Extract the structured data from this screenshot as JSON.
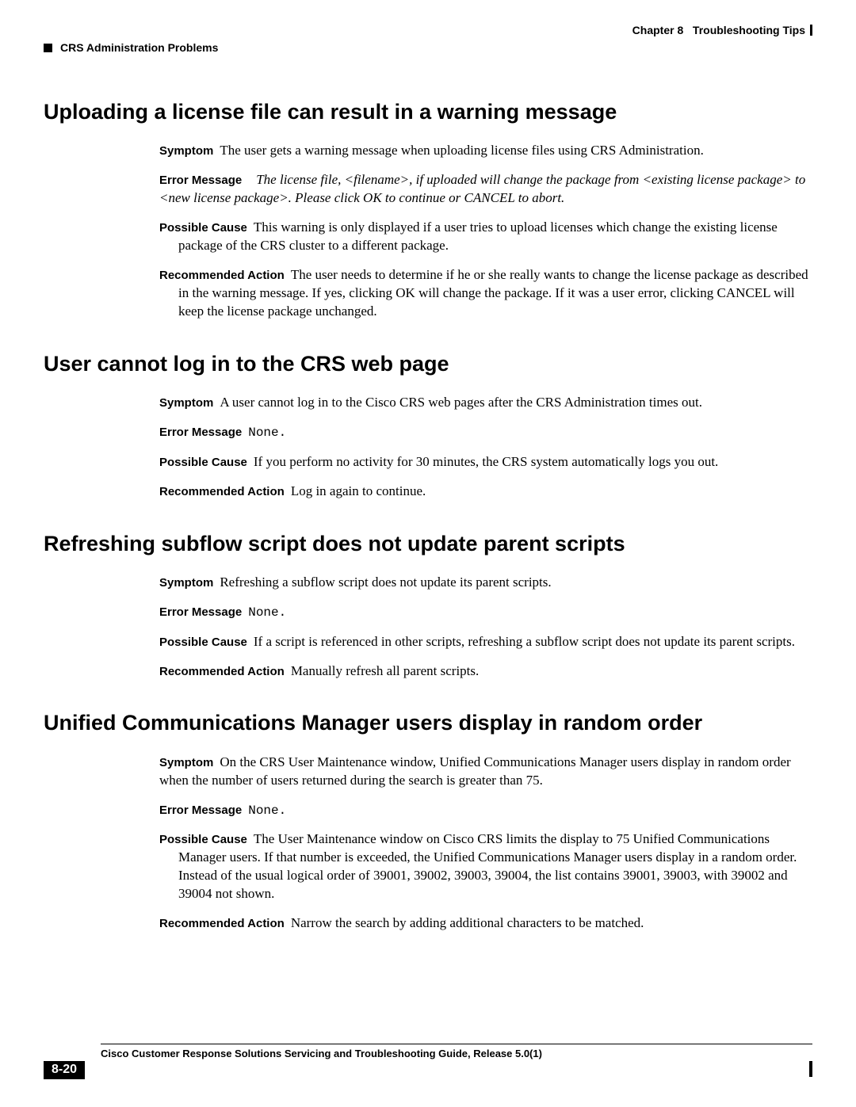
{
  "header": {
    "chapter_label": "Chapter 8",
    "chapter_title": "Troubleshooting Tips",
    "section_title": "CRS Administration Problems"
  },
  "labels": {
    "symptom": "Symptom",
    "error_message": "Error Message",
    "possible_cause": "Possible Cause",
    "recommended_action": "Recommended Action",
    "none": "None."
  },
  "sections": [
    {
      "heading": "Uploading a license file can result in a warning message",
      "symptom": "The user gets a warning message when uploading license files using CRS Administration.",
      "error_msg": "The license file, <filename>, if uploaded will change the package from <existing license package> to <new license package>. Please click OK to continue or CANCEL to abort.",
      "error_is_none": false,
      "cause": "This warning is only displayed if a user tries to upload licenses which change the existing license package of the CRS cluster to a different package.",
      "action": "The user needs to determine if he or she really wants to change the license package as described in the warning message. If yes, clicking OK will change the package. If it was a user error, clicking CANCEL will keep the license package unchanged."
    },
    {
      "heading": "User cannot log in to the CRS web page",
      "symptom": "A user cannot log in to the Cisco CRS web pages after the CRS Administration times out.",
      "error_msg": "",
      "error_is_none": true,
      "cause": "If you perform no activity for 30 minutes, the CRS system automatically logs you out.",
      "action": "Log in again to continue."
    },
    {
      "heading": "Refreshing subflow script does not update parent scripts",
      "symptom": "Refreshing a subflow script does not update its parent scripts.",
      "error_msg": "",
      "error_is_none": true,
      "cause": "If a script is referenced in other scripts, refreshing a subflow script does not update its parent scripts.",
      "action": "Manually refresh all parent scripts."
    },
    {
      "heading": "Unified Communications Manager users display in random order",
      "symptom": "On the CRS User Maintenance window, Unified Communications Manager users display in random order when the number of users returned during the search is greater than 75.",
      "error_msg": "",
      "error_is_none": true,
      "cause": "The User Maintenance window on Cisco CRS limits the display to 75 Unified Communications Manager users. If that number is exceeded, the Unified Communications Manager users display in a random order. Instead of the usual logical order of 39001, 39002, 39003, 39004, the list contains 39001, 39003, with 39002 and 39004 not shown.",
      "action": "Narrow the search by adding additional characters to be matched."
    }
  ],
  "footer": {
    "doc_title": "Cisco Customer Response Solutions Servicing and Troubleshooting Guide, Release 5.0(1)",
    "page_number": "8-20"
  }
}
